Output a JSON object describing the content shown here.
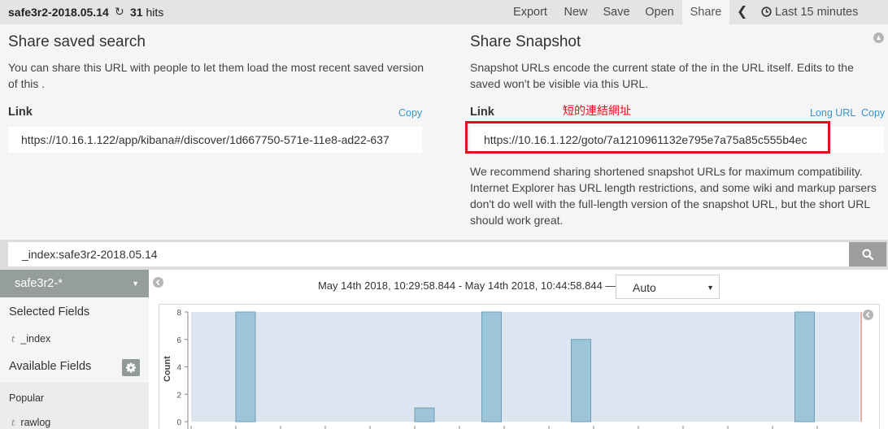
{
  "topbar": {
    "index_title": "safe3r2-2018.05.14",
    "hit_count": "31",
    "hits_label": "hits",
    "menu": [
      {
        "label": "Export"
      },
      {
        "label": "New"
      },
      {
        "label": "Save"
      },
      {
        "label": "Open"
      },
      {
        "label": "Share",
        "active": true
      }
    ],
    "time_range": "Last 15 minutes"
  },
  "share_saved_search": {
    "title": "Share saved search",
    "description": "You can share this URL with people to let them load the most recent saved version of this .",
    "link_label": "Link",
    "copy_label": "Copy",
    "url": "https://10.16.1.122/app/kibana#/discover/1d667750-571e-11e8-ad22-637"
  },
  "share_snapshot": {
    "title": "Share Snapshot",
    "description": "Snapshot URLs encode the current state of the in the URL itself. Edits to the saved won't be visible via this URL.",
    "link_label": "Link",
    "long_url_label": "Long URL",
    "copy_label": "Copy",
    "url": "https://10.16.1.122/goto/7a1210961132e795e7a75a85c555b4ec",
    "recommendation": "We recommend sharing shortened snapshot URLs for maximum compatibility. Internet Explorer has URL length restrictions, and some wiki and markup parsers don't do well with the full-length version of the snapshot URL, but the short URL should work great.",
    "annotation": "短的連結網址",
    "annotation_color": "#e6101a"
  },
  "search": {
    "query": "_index:safe3r2-2018.05.14"
  },
  "sidebar": {
    "index_pattern": "safe3r2-*",
    "selected_fields_label": "Selected Fields",
    "selected_fields": [
      {
        "type": "t",
        "name": "_index"
      }
    ],
    "available_fields_label": "Available Fields",
    "popular_label": "Popular",
    "popular_fields": [
      {
        "type": "t",
        "name": "rawlog"
      }
    ]
  },
  "histogram": {
    "time_range_text": "May 14th 2018, 10:29:58.844 - May 14th 2018, 10:44:58.844 —",
    "interval": "Auto"
  },
  "chart_data": {
    "type": "bar",
    "ylabel": "Count",
    "ylim": [
      0,
      8
    ],
    "yticks": [
      0,
      2,
      4,
      6,
      8
    ],
    "bars": [
      {
        "slot": 1,
        "value": 8
      },
      {
        "slot": 5,
        "value": 1
      },
      {
        "slot": 6.5,
        "value": 8
      },
      {
        "slot": 8.5,
        "value": 6
      },
      {
        "slot": 13.5,
        "value": 8
      }
    ],
    "bar_color": "#9cc5d9",
    "bar_stroke": "#6f9fb7",
    "plot_background": "#dbe6f1",
    "grid": false
  }
}
